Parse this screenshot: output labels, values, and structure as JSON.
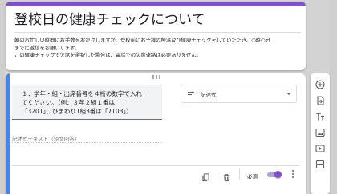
{
  "form": {
    "title": "登校日の健康チェックについて",
    "description": [
      "朝のお忙しい時間にお手数をおかけしますが、登校前にお子様の検温及び健康チェックをしていただき、○時○分",
      "までに返信をお願いします。",
      "この健康チェックで欠席を選択した場合は、電話での欠席連絡は必要ありません。"
    ]
  },
  "question": {
    "text_lines": [
      "１．学年・組・出席番号を４桁の数字で入れ",
      "てください。（例：３年２組１番は",
      "「3201」、ひまわり1組3番は「7103」）"
    ],
    "type_label": "記述式",
    "answer_placeholder": "記述式テキスト（短文回答）",
    "required_label": "必須",
    "required_on": true
  },
  "colors": {
    "accent": "#7d52c9",
    "active_bar": "#4285f4",
    "background": "#d3d3d3"
  },
  "toolbar": {
    "icons": [
      "add-question-icon",
      "import-questions-icon",
      "add-title-icon",
      "add-image-icon",
      "add-video-icon",
      "add-section-icon"
    ]
  }
}
